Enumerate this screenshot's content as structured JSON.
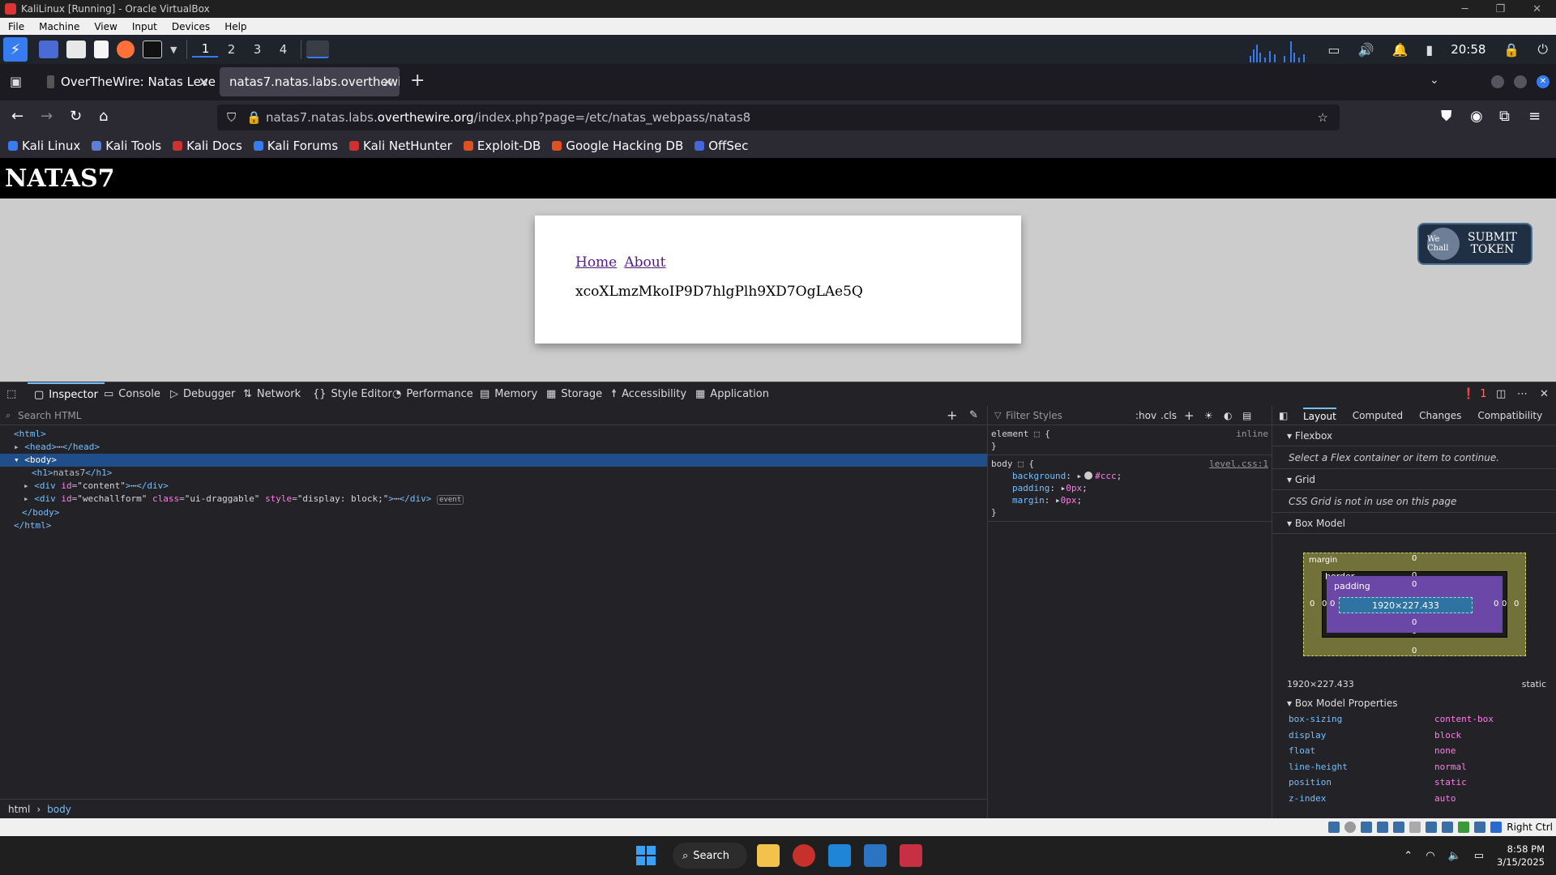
{
  "vbox": {
    "title": "KaliLinux [Running] - Oracle VirtualBox",
    "menu": [
      "File",
      "Machine",
      "View",
      "Input",
      "Devices",
      "Help"
    ],
    "status_text": "Right Ctrl"
  },
  "panel": {
    "workspaces": [
      "1",
      "2",
      "3",
      "4"
    ],
    "clock": "20:58"
  },
  "browser": {
    "tabs": [
      {
        "title": "OverTheWire: Natas Leve"
      },
      {
        "title": "natas7.natas.labs.overthewir"
      }
    ],
    "url_prefix": "natas7.natas.labs.",
    "url_domain": "overthewire.org",
    "url_suffix": "/index.php?page=/etc/natas_webpass/natas8",
    "bookmarks": [
      {
        "label": "Kali Linux",
        "color": "#367bf0"
      },
      {
        "label": "Kali Tools",
        "color": "#5b7fd6"
      },
      {
        "label": "Kali Docs",
        "color": "#d03030"
      },
      {
        "label": "Kali Forums",
        "color": "#367bf0"
      },
      {
        "label": "Kali NetHunter",
        "color": "#d03030"
      },
      {
        "label": "Exploit-DB",
        "color": "#e05020"
      },
      {
        "label": "Google Hacking DB",
        "color": "#e05020"
      },
      {
        "label": "OffSec",
        "color": "#4466dd"
      }
    ]
  },
  "page": {
    "header": "NATAS7",
    "link_home": "Home",
    "link_about": "About",
    "password": "xcoXLmzMkoIP9D7hlgPlh9XD7OgLAe5Q",
    "submit_line1": "SUBMIT",
    "submit_line2": "TOKEN",
    "submit_logo": "We Chall"
  },
  "devtools": {
    "tabs": [
      "Inspector",
      "Console",
      "Debugger",
      "Network",
      "Style Editor",
      "Performance",
      "Memory",
      "Storage",
      "Accessibility",
      "Application"
    ],
    "error_count": "1",
    "search_placeholder": "Search HTML",
    "filter_placeholder": "Filter Styles",
    "hov": ":hov",
    "cls": ".cls",
    "breadcrumbs": [
      "html",
      "body"
    ],
    "rules": {
      "element_selector": "element",
      "element_origin": "inline",
      "body_selector": "body",
      "body_origin": "level.css:1",
      "props": [
        {
          "name": "background",
          "value": "#ccc"
        },
        {
          "name": "padding",
          "value": "0px"
        },
        {
          "name": "margin",
          "value": "0px"
        }
      ]
    },
    "layout_tabs": [
      "Layout",
      "Computed",
      "Changes",
      "Compatibility"
    ],
    "flexbox_label": "Flexbox",
    "flexbox_note": "Select a Flex container or item to continue.",
    "grid_label": "Grid",
    "grid_note": "CSS Grid is not in use on this page",
    "boxmodel_label": "Box Model",
    "boxmodel": {
      "margin": "margin",
      "border": "border",
      "padding": "padding",
      "content": "1920×227.433",
      "zero": "0"
    },
    "dims": "1920×227.433",
    "position": "static",
    "props_label": "Box Model Properties",
    "box_props": [
      {
        "k": "box-sizing",
        "v": "content-box"
      },
      {
        "k": "display",
        "v": "block"
      },
      {
        "k": "float",
        "v": "none"
      },
      {
        "k": "line-height",
        "v": "normal"
      },
      {
        "k": "position",
        "v": "static"
      },
      {
        "k": "z-index",
        "v": "auto"
      }
    ]
  },
  "taskbar": {
    "search": "Search",
    "time": "8:58 PM",
    "date": "3/15/2025"
  }
}
